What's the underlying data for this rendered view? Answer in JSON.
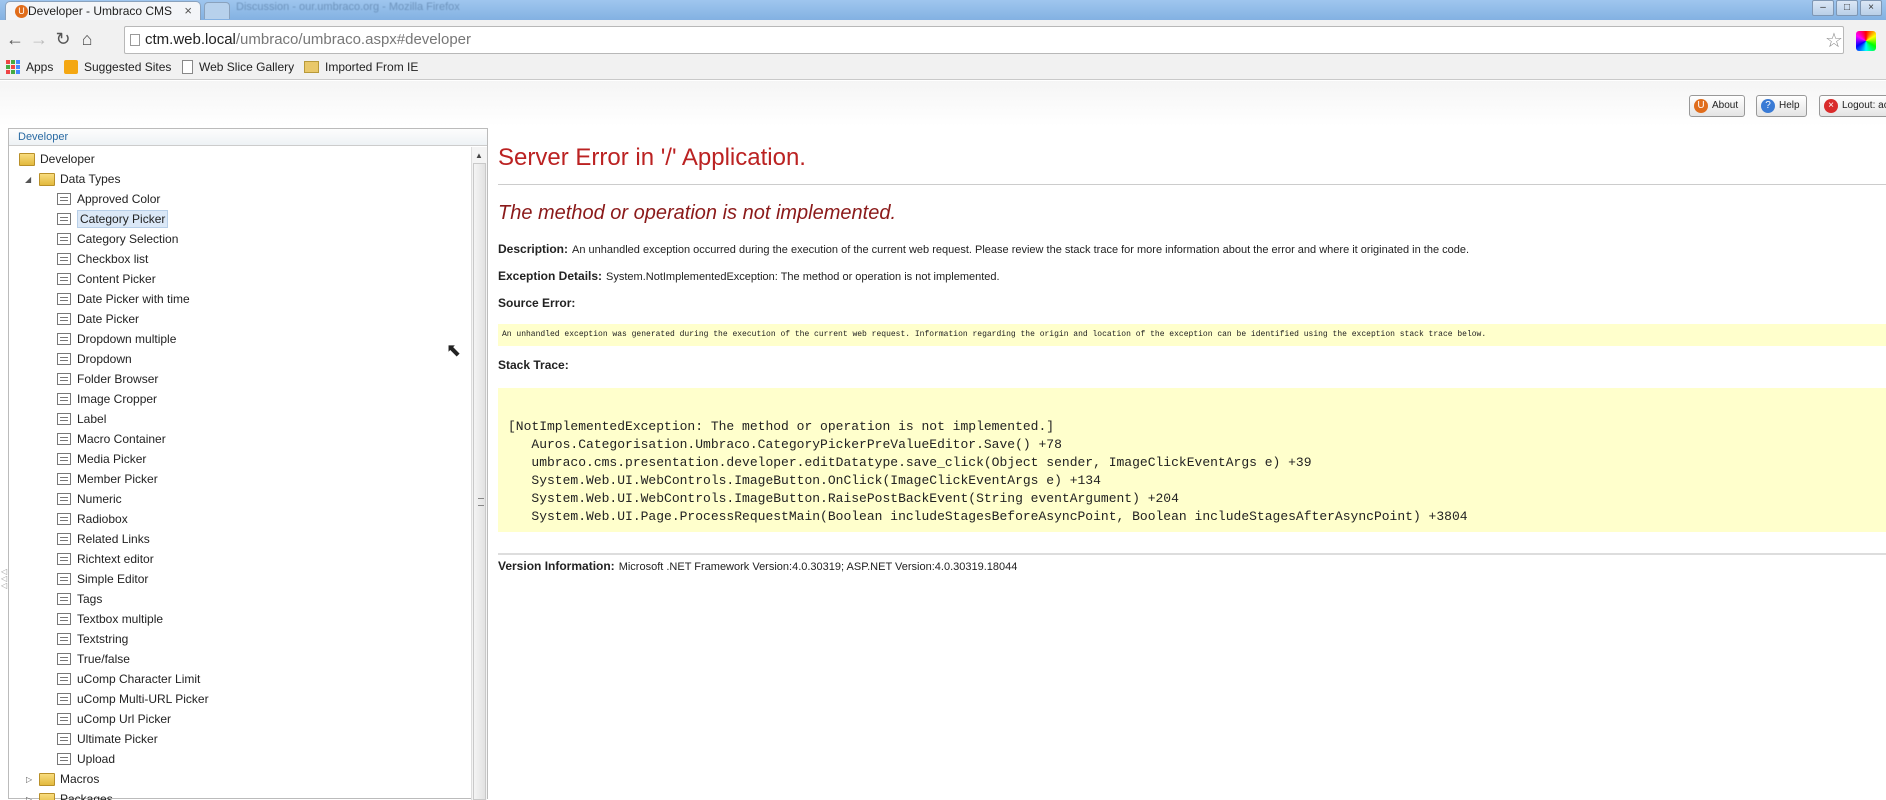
{
  "browser": {
    "tab_title": "Developer - Umbraco CMS",
    "tab_close": "×",
    "second_tab_blurred": "Discussion - our.umbraco.org - Mozilla Firefox",
    "url_host": "ctm.web.local",
    "url_path": "/umbraco/umbraco.aspx#developer",
    "bookmarks": [
      "Apps",
      "Suggested Sites",
      "Web Slice Gallery",
      "Imported From IE"
    ]
  },
  "header": {
    "buttons": [
      {
        "label": "About",
        "color": "#e06d1c"
      },
      {
        "label": "Help",
        "color": "#3a7bd5"
      },
      {
        "label": "Logout: ac",
        "color": "#d92b2b"
      }
    ]
  },
  "sidebar": {
    "title": "Developer",
    "root": "Developer",
    "group": "Data Types",
    "items": [
      "Approved Color",
      "Category Picker",
      "Category Selection",
      "Checkbox list",
      "Content Picker",
      "Date Picker with time",
      "Date Picker",
      "Dropdown multiple",
      "Dropdown",
      "Folder Browser",
      "Image Cropper",
      "Label",
      "Macro Container",
      "Media Picker",
      "Member Picker",
      "Numeric",
      "Radiobox",
      "Related Links",
      "Richtext editor",
      "Simple Editor",
      "Tags",
      "Textbox multiple",
      "Textstring",
      "True/false",
      "uComp Character Limit",
      "uComp Multi-URL Picker",
      "uComp Url Picker",
      "Ultimate Picker",
      "Upload"
    ],
    "selected_index": 1,
    "siblings": [
      "Macros",
      "Packages"
    ]
  },
  "error": {
    "title": "Server Error in '/' Application.",
    "message": "The method or operation is not implemented.",
    "description_label": "Description:",
    "description": "An unhandled exception occurred during the execution of the current web request. Please review the stack trace for more information about the error and where it originated in the code.",
    "exception_label": "Exception Details:",
    "exception": "System.NotImplementedException: The method or operation is not implemented.",
    "source_label": "Source Error:",
    "source_text": "An unhandled exception was generated during the execution of the current web request. Information regarding the origin and location of the exception can be identified using the exception stack trace below.",
    "stack_label": "Stack Trace:",
    "stack_trace": "[NotImplementedException: The method or operation is not implemented.]\n   Auros.Categorisation.Umbraco.CategoryPickerPreValueEditor.Save() +78\n   umbraco.cms.presentation.developer.editDatatype.save_click(Object sender, ImageClickEventArgs e) +39\n   System.Web.UI.WebControls.ImageButton.OnClick(ImageClickEventArgs e) +134\n   System.Web.UI.WebControls.ImageButton.RaisePostBackEvent(String eventArgument) +204\n   System.Web.UI.Page.ProcessRequestMain(Boolean includeStagesBeforeAsyncPoint, Boolean includeStagesAfterAsyncPoint) +3804",
    "version_label": "Version Information:",
    "version": "Microsoft .NET Framework Version:4.0.30319; ASP.NET Version:4.0.30319.18044"
  }
}
